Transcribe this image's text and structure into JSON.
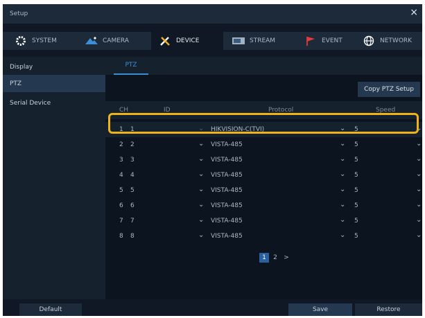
{
  "window": {
    "title": "Setup",
    "close_label": "×"
  },
  "tabs": [
    {
      "label": "SYSTEM",
      "icon": "gear-icon"
    },
    {
      "label": "CAMERA",
      "icon": "camera-icon"
    },
    {
      "label": "DEVICE",
      "icon": "tools-icon",
      "active": true
    },
    {
      "label": "STREAM",
      "icon": "stream-icon"
    },
    {
      "label": "EVENT",
      "icon": "flag-icon"
    },
    {
      "label": "NETWORK",
      "icon": "globe-icon"
    }
  ],
  "sidebar": {
    "items": [
      {
        "label": "Display"
      },
      {
        "label": "PTZ",
        "selected": true
      },
      {
        "label": "Serial Device"
      }
    ]
  },
  "subtab": {
    "label": "PTZ"
  },
  "copy_button": {
    "label": "Copy PTZ Setup"
  },
  "table": {
    "headers": {
      "ch": "CH",
      "id": "ID",
      "protocol": "Protocol",
      "speed": "Speed"
    },
    "rows": [
      {
        "ch": "1",
        "id": "1",
        "protocol": "HIKVISION-C(TVI)",
        "speed": "5",
        "highlighted": true
      },
      {
        "ch": "2",
        "id": "2",
        "protocol": "VISTA-485",
        "speed": "5"
      },
      {
        "ch": "3",
        "id": "3",
        "protocol": "VISTA-485",
        "speed": "5"
      },
      {
        "ch": "4",
        "id": "4",
        "protocol": "VISTA-485",
        "speed": "5"
      },
      {
        "ch": "5",
        "id": "5",
        "protocol": "VISTA-485",
        "speed": "5"
      },
      {
        "ch": "6",
        "id": "6",
        "protocol": "VISTA-485",
        "speed": "5"
      },
      {
        "ch": "7",
        "id": "7",
        "protocol": "VISTA-485",
        "speed": "5"
      },
      {
        "ch": "8",
        "id": "8",
        "protocol": "VISTA-485",
        "speed": "5"
      }
    ]
  },
  "pagination": {
    "pages": [
      "1",
      "2"
    ],
    "current": "1",
    "next": ">"
  },
  "footer": {
    "default_label": "Default",
    "save_label": "Save",
    "restore_label": "Restore"
  },
  "colors": {
    "highlight": "#f0b21b",
    "accent": "#3d8ed8",
    "event_flag": "#e23b3b"
  }
}
